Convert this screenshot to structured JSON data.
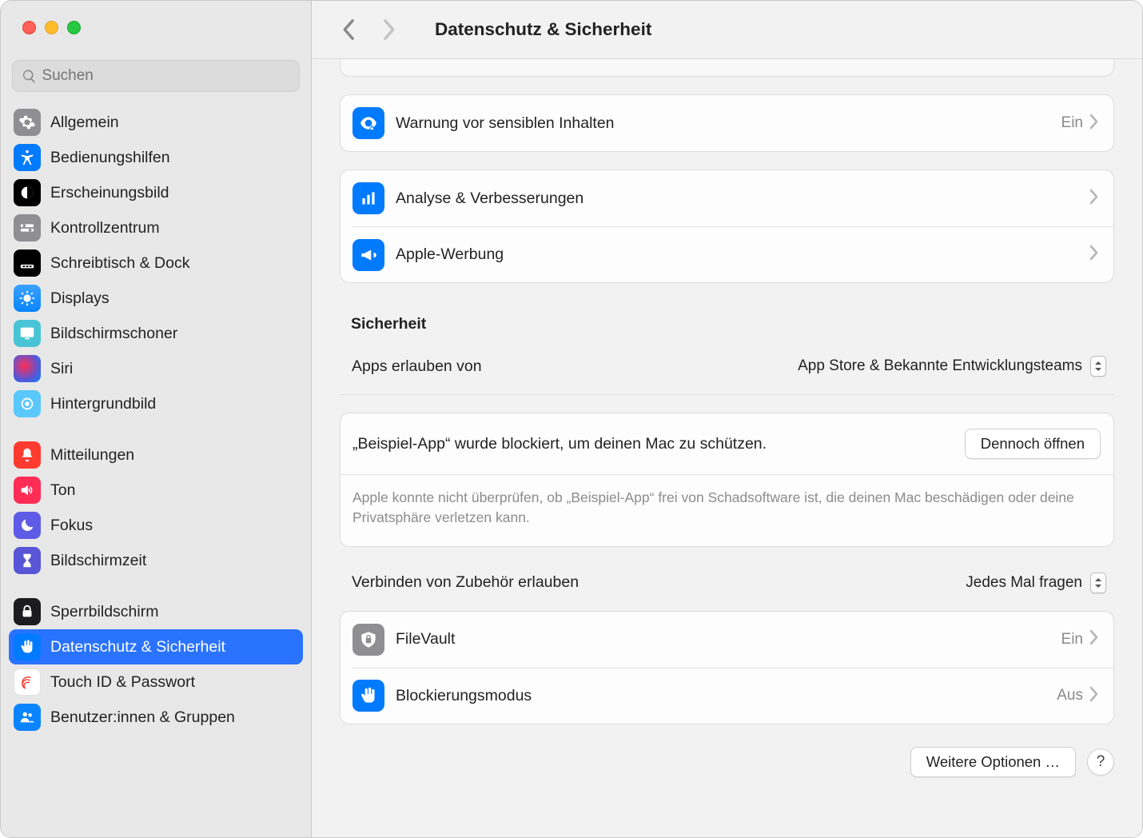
{
  "search": {
    "placeholder": "Suchen"
  },
  "sidebar": {
    "items": [
      {
        "label": "Allgemein"
      },
      {
        "label": "Bedienungshilfen"
      },
      {
        "label": "Erscheinungsbild"
      },
      {
        "label": "Kontrollzentrum"
      },
      {
        "label": "Schreibtisch & Dock"
      },
      {
        "label": "Displays"
      },
      {
        "label": "Bildschirmschoner"
      },
      {
        "label": "Siri"
      },
      {
        "label": "Hintergrundbild"
      },
      {
        "label": "Mitteilungen"
      },
      {
        "label": "Ton"
      },
      {
        "label": "Fokus"
      },
      {
        "label": "Bildschirmzeit"
      },
      {
        "label": "Sperrbildschirm"
      },
      {
        "label": "Datenschutz & Sicherheit"
      },
      {
        "label": "Touch ID & Passwort"
      },
      {
        "label": "Benutzer:innen & Gruppen"
      }
    ]
  },
  "header": {
    "title": "Datenschutz & Sicherheit"
  },
  "rows": {
    "sensitive": {
      "label": "Warnung vor sensiblen Inhalten",
      "value": "Ein"
    },
    "analytics": {
      "label": "Analyse & Verbesserungen"
    },
    "ads": {
      "label": "Apple-Werbung"
    },
    "filevault": {
      "label": "FileVault",
      "value": "Ein"
    },
    "lockdown": {
      "label": "Blockierungsmodus",
      "value": "Aus"
    }
  },
  "security": {
    "heading": "Sicherheit",
    "allow_apps_label": "Apps erlauben von",
    "allow_apps_value": "App Store & Bekannte Entwicklungsteams",
    "blocked_msg": "„Beispiel-App“ wurde blockiert, um deinen Mac zu schützen.",
    "open_anyway": "Dennoch öffnen",
    "blocked_desc": "Apple konnte nicht überprüfen, ob „Beispiel-App“ frei von Schadsoftware ist, die deinen Mac beschädigen oder deine Privatsphäre verletzen kann.",
    "accessories_label": "Verbinden von Zubehör erlauben",
    "accessories_value": "Jedes Mal fragen"
  },
  "footer": {
    "more": "Weitere Optionen …",
    "help": "?"
  }
}
